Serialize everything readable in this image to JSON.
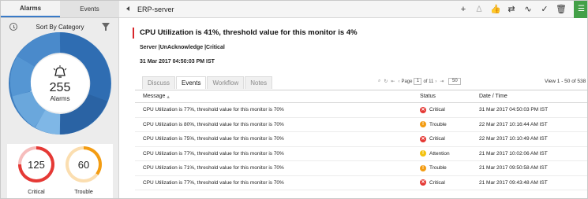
{
  "left": {
    "tabs": [
      "Alarms",
      "Events"
    ],
    "category_title": "Sort By Category",
    "donut": {
      "count": "255",
      "label": "Alarms"
    },
    "mini": [
      {
        "count": "125",
        "label": "Critical",
        "color": "#e53935",
        "fill": 0.75
      },
      {
        "count": "60",
        "label": "Trouble",
        "color": "#f39c12",
        "fill": 0.35
      }
    ]
  },
  "topbar": {
    "server": "ERP-server",
    "tools": [
      "+",
      "∆",
      "👍",
      "⇄",
      "∿",
      "✓",
      "🗑"
    ],
    "export_icon": "☰"
  },
  "alert": {
    "message": "CPU Utilization is 41%, threshold value for this monitor is 4%",
    "tags": "Server  |UnAcknowledge  |Critical",
    "time": "31 Mar 2017 04:50:03 PM IST"
  },
  "tabs": [
    "Discuss",
    "Events",
    "Workflow",
    "Notes"
  ],
  "pager": {
    "page_label": "Page",
    "page": "1",
    "of": "of 11",
    "per_page": "50",
    "view": "View 1 - 50 of 538"
  },
  "table": {
    "headers": [
      "Message",
      "Status",
      "Date / Time"
    ],
    "rows": [
      {
        "message": "CPU Utilization is 77%, threshold value for this monitor is 70%",
        "status": "Critical",
        "kind": "crit",
        "date": "31 Mar 2017 04:50:03 PM IST"
      },
      {
        "message": "CPU Utilization is 80%, threshold value for this monitor is 70%",
        "status": "Trouble",
        "kind": "trouble",
        "date": "22 Mar 2017 10:16:44 AM IST"
      },
      {
        "message": "CPU Utilization is 75%, threshold value for this monitor is 70%",
        "status": "Critical",
        "kind": "crit",
        "date": "22 Mar 2017 10:10:49 AM IST"
      },
      {
        "message": "CPU Utilization is 77%, threshold value for this monitor is 70%",
        "status": "Attention",
        "kind": "attn",
        "date": "21 Mar 2017 10:02:06 AM IST"
      },
      {
        "message": "CPU Utilization is 71%, threshold value for this monitor is 70%",
        "status": "Trouble",
        "kind": "trouble",
        "date": "21 Mar 2017 09:50:58 AM IST"
      },
      {
        "message": "CPU Utilization is 77%, threshold value for this monitor is 70%",
        "status": "Critical",
        "kind": "crit",
        "date": "21 Mar 2017 09:43:48 AM IST"
      }
    ]
  },
  "colors": {
    "accent": "#3a7bc8",
    "critical": "#e53935",
    "trouble": "#f39c12",
    "attention": "#f4c20d",
    "export": "#43a047"
  }
}
